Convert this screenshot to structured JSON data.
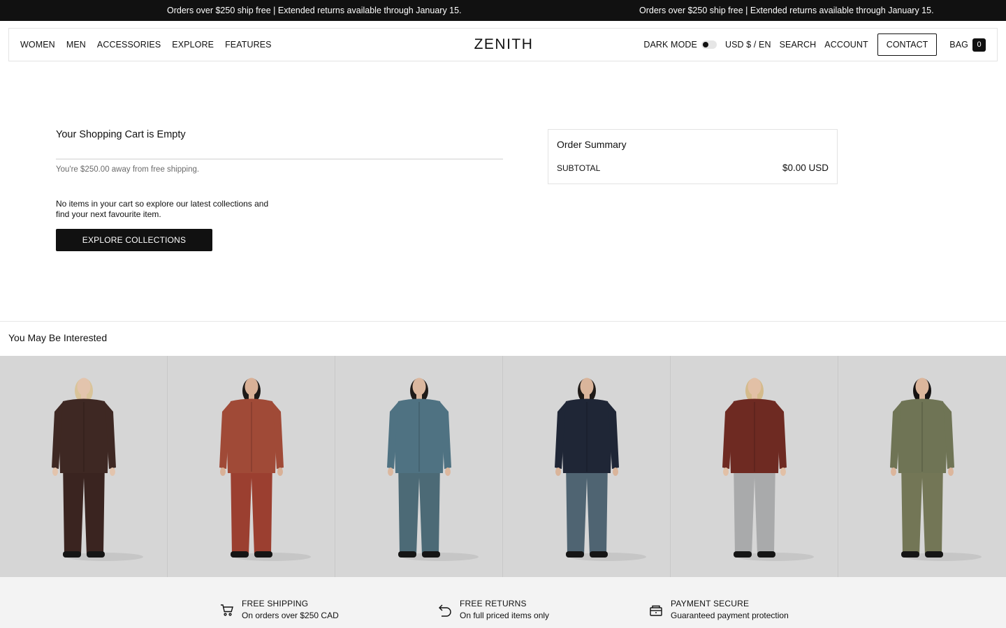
{
  "announcement": {
    "message_1": "Orders over $250 ship free | Extended returns available through January 15.",
    "message_2": "Orders over $250 ship free | Extended returns available through January 15."
  },
  "header": {
    "nav": [
      "WOMEN",
      "MEN",
      "ACCESSORIES",
      "EXPLORE",
      "FEATURES"
    ],
    "logo": "ZENITH",
    "dark_mode_label": "DARK MODE",
    "dark_mode_on": false,
    "currency": "USD $ / EN",
    "search": "SEARCH",
    "account": "ACCOUNT",
    "contact": "CONTACT",
    "bag": "BAG",
    "bag_count": "0"
  },
  "cart": {
    "title": "Your Shopping Cart is Empty",
    "shipping_note": "You're $250.00 away from free shipping.",
    "empty_message": "No items in your cart so explore our latest collections and find your next favourite item.",
    "explore_button": "EXPLORE COLLECTIONS"
  },
  "summary": {
    "title": "Order Summary",
    "subtotal_label": "SUBTOTAL",
    "subtotal_value": "$0.00 USD"
  },
  "recommendations": {
    "title": "You May Be Interested",
    "products": [
      {
        "top_color": "#3e2823",
        "bottom_color": "#3a2420",
        "skin": "#e3c4ad",
        "hair": "#d9c49a"
      },
      {
        "top_color": "#a04a37",
        "bottom_color": "#9b3f30",
        "skin": "#d9b197",
        "hair": "#1e1a18"
      },
      {
        "top_color": "#4f7282",
        "bottom_color": "#4c6a76",
        "skin": "#dcb89f",
        "hair": "#201b18"
      },
      {
        "top_color": "#1f2636",
        "bottom_color": "#4f6472",
        "skin": "#dab59b",
        "hair": "#1f1a17"
      },
      {
        "top_color": "#6e2a22",
        "bottom_color": "#a9aaab",
        "skin": "#e2c0a6",
        "hair": "#d4bb8c"
      },
      {
        "top_color": "#6f7455",
        "bottom_color": "#737656",
        "skin": "#dcb69c",
        "hair": "#151212"
      }
    ]
  },
  "footer": {
    "features": [
      {
        "icon": "cart-icon",
        "title": "FREE SHIPPING",
        "subtitle": "On orders over $250 CAD"
      },
      {
        "icon": "return-arrow-icon",
        "title": "FREE RETURNS",
        "subtitle": "On full priced items only"
      },
      {
        "icon": "secure-payment-icon",
        "title": "PAYMENT SECURE",
        "subtitle": "Guaranteed payment protection"
      }
    ]
  }
}
